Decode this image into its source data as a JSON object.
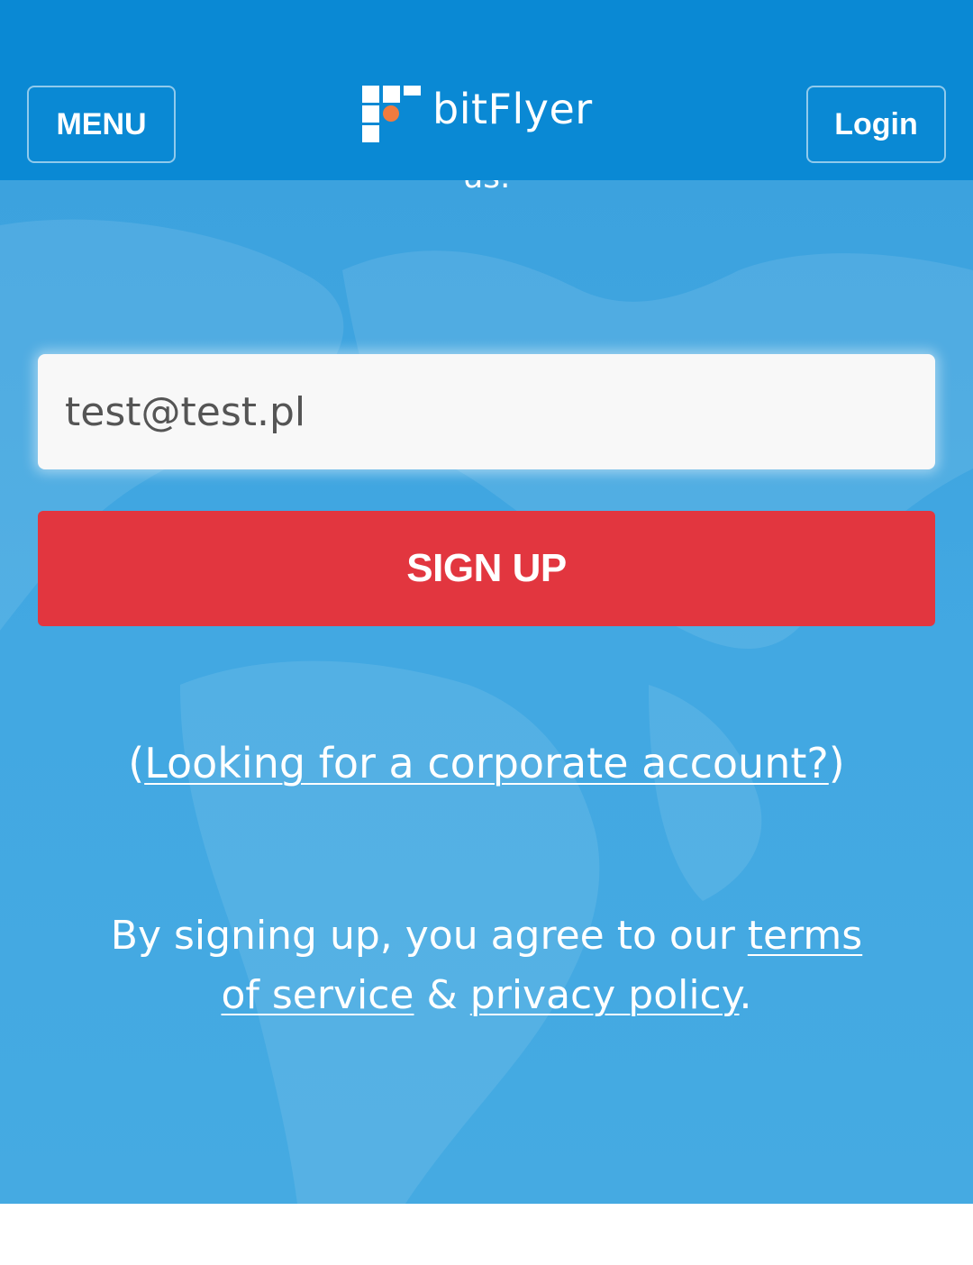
{
  "header": {
    "menu_label": "MENU",
    "brand_name": "bitFlyer",
    "login_label": "Login",
    "background_color": "#0a89d4"
  },
  "intro": {
    "cut_off_text": "us."
  },
  "form": {
    "email_value": "test@test.pl",
    "signup_label": "SIGN UP",
    "signup_color": "#e2363f"
  },
  "corporate": {
    "open_paren": "(",
    "link_text": "Looking for a corporate account?",
    "close_paren": ")"
  },
  "terms": {
    "prefix": "By signing up, you agree to our ",
    "terms_link": "terms of service",
    "joiner": " & ",
    "privacy_link": "privacy policy",
    "suffix": "."
  },
  "icons": {
    "logo": "bitflyer-logo-icon",
    "background": "world-map-icon"
  },
  "colors": {
    "hero": "#42a8e2",
    "logo_dot": "#f07b3f"
  }
}
